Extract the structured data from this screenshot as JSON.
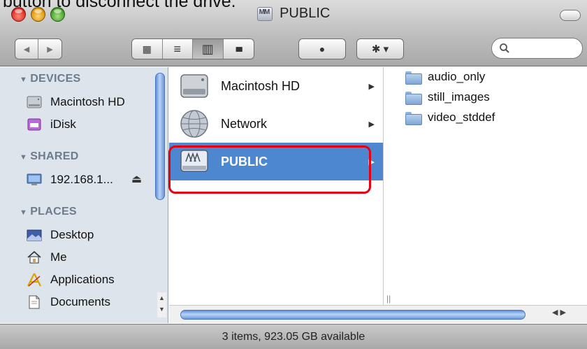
{
  "caption": "button to disconnect the drive.",
  "window": {
    "title": "PUBLIC"
  },
  "toolbar": {
    "back_label": "◀",
    "forward_label": "▶",
    "view_icon_label": "▦",
    "view_list_label": "≡",
    "view_columns_label": "▥",
    "view_coverflow_label": "▮▮▮",
    "quicklook_label": "●",
    "action_label": "✱ ▾",
    "search_placeholder": ""
  },
  "sidebar": {
    "sections": [
      {
        "title": "DEVICES",
        "items": [
          {
            "label": "Macintosh HD",
            "icon": "hard-drive-icon"
          },
          {
            "label": "iDisk",
            "icon": "idisk-icon"
          }
        ]
      },
      {
        "title": "SHARED",
        "items": [
          {
            "label": "192.168.1...",
            "icon": "monitor-icon"
          }
        ]
      },
      {
        "title": "PLACES",
        "items": [
          {
            "label": "Desktop",
            "icon": "desktop-icon"
          },
          {
            "label": "Me",
            "icon": "home-icon"
          },
          {
            "label": "Applications",
            "icon": "applications-icon"
          },
          {
            "label": "Documents",
            "icon": "documents-icon"
          }
        ]
      }
    ],
    "eject_label": "⏏"
  },
  "column1": {
    "items": [
      {
        "label": "Macintosh HD",
        "icon": "hard-drive-icon",
        "selected": false
      },
      {
        "label": "Network",
        "icon": "network-globe-icon",
        "selected": false
      },
      {
        "label": "PUBLIC",
        "icon": "network-drive-icon",
        "selected": true
      }
    ]
  },
  "column2": {
    "items": [
      {
        "label": "audio_only",
        "icon": "folder-icon"
      },
      {
        "label": "still_images",
        "icon": "folder-icon"
      },
      {
        "label": "video_stddef",
        "icon": "folder-icon"
      }
    ]
  },
  "status": {
    "text": "3 items, 923.05 GB available"
  },
  "colors": {
    "selection": "#4c87d0",
    "highlight_box": "#e60012",
    "sidebar_bg": "#dde4ec"
  }
}
